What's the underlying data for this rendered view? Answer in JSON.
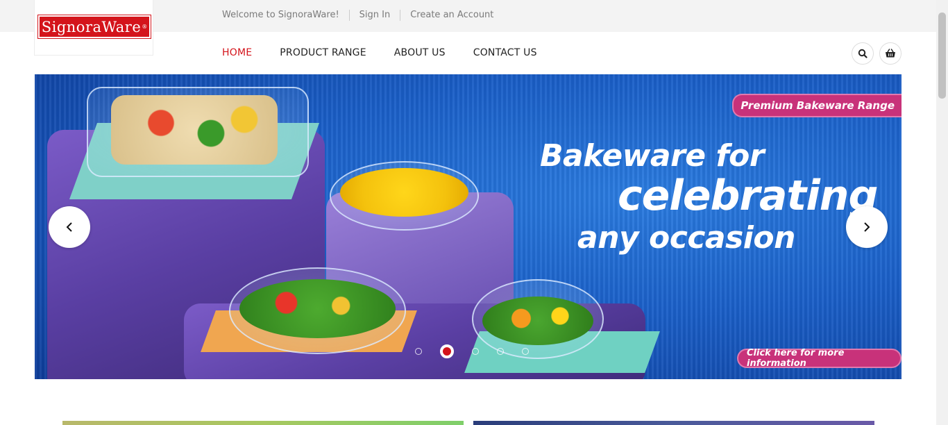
{
  "brand": {
    "logo_text": "SignoraWare",
    "logo_mark": "®",
    "accent": "#d4141b"
  },
  "topbar": {
    "welcome": "Welcome to SignoraWare!",
    "sign_in": "Sign In",
    "create_account": "Create an Account"
  },
  "nav": {
    "items": [
      {
        "label": "HOME",
        "active": true
      },
      {
        "label": "PRODUCT RANGE",
        "active": false
      },
      {
        "label": "ABOUT US",
        "active": false
      },
      {
        "label": "CONTACT US",
        "active": false
      }
    ]
  },
  "header_icons": {
    "search": "search-icon",
    "cart": "basket-icon"
  },
  "slider": {
    "tag": "Premium Bakeware Range",
    "headline_1": "Bakeware for",
    "headline_2": "celebrating",
    "headline_3": "any occasion",
    "cta": "Click here for more information",
    "slide_count": 5,
    "active_slide": 2,
    "prev_icon": "chevron-left-icon",
    "next_icon": "chevron-right-icon"
  }
}
